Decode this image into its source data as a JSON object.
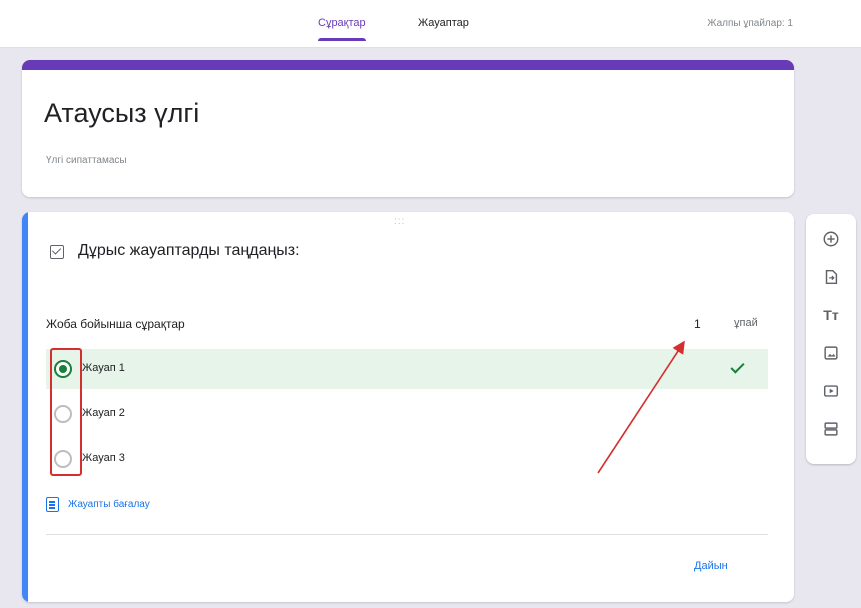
{
  "tabs": [
    {
      "label": "Сұрақтар",
      "active": true
    },
    {
      "label": "Жауаптар",
      "active": false
    }
  ],
  "total_score": "Жалпы ұпайлар: 1",
  "form": {
    "title": "Атаусыз үлгі",
    "description": "Үлгі сипаттамасы"
  },
  "question_card": {
    "drag_handle": ":::",
    "heading": "Дұрыс жауаптарды таңдаңыз:",
    "question": "Жоба бойынша сұрақтар",
    "points_value": "1",
    "points_unit": "ұпай",
    "options": [
      {
        "label": "Жауап 1",
        "correct": true
      },
      {
        "label": "Жауап 2",
        "correct": false
      },
      {
        "label": "Жауап 3",
        "correct": false
      }
    ],
    "grade_link": "Жауапты бағалау",
    "done_label": "Дайын"
  },
  "colors": {
    "accent": "#673ab7",
    "focus_bar": "#4285f4",
    "correct": "#188038",
    "correct_bg": "#e6f4ea",
    "link": "#1a73e8",
    "annotation": "#d32f2f"
  },
  "toolbar_icons": [
    "add-question-icon",
    "import-questions-icon",
    "add-title-icon",
    "add-image-icon",
    "add-video-icon",
    "add-section-icon"
  ]
}
